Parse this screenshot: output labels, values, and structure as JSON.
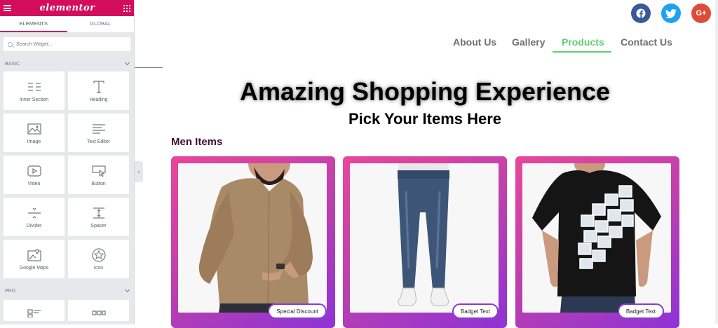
{
  "panel": {
    "brand": "elementor",
    "tabs": [
      "ELEMENTS",
      "GLOBAL"
    ],
    "search_placeholder": "Search Widget...",
    "basic_title": "BASIC",
    "pro_title": "PRO",
    "widgets": [
      {
        "label": "Inner Section",
        "icon": "inner-section-icon"
      },
      {
        "label": "Heading",
        "icon": "heading-icon"
      },
      {
        "label": "Image",
        "icon": "image-icon"
      },
      {
        "label": "Text Editor",
        "icon": "text-editor-icon"
      },
      {
        "label": "Video",
        "icon": "video-icon"
      },
      {
        "label": "Button",
        "icon": "button-icon"
      },
      {
        "label": "Divider",
        "icon": "divider-icon"
      },
      {
        "label": "Spacer",
        "icon": "spacer-icon"
      },
      {
        "label": "Google Maps",
        "icon": "google-maps-icon"
      },
      {
        "label": "Icon",
        "icon": "star-icon"
      }
    ]
  },
  "social": {
    "facebook": "f",
    "twitter": "t",
    "googleplus": "G+"
  },
  "nav": {
    "items": [
      "About Us",
      "Gallery",
      "Products",
      "Contact Us"
    ],
    "active": "Products"
  },
  "hero": {
    "title": "Amazing Shopping Experience",
    "subtitle": "Pick Your Items Here"
  },
  "section": {
    "title": "Men Items"
  },
  "cards": [
    {
      "badge": "Special Discount",
      "image": "man-in-brown-shirt"
    },
    {
      "badge": "Badget Text",
      "image": "blue-jeans-white-sneakers"
    },
    {
      "badge": "Badget Text",
      "image": "black-photo-print-tshirt"
    }
  ],
  "colors": {
    "brand": "#d30c5c",
    "nav_active": "#61ce70",
    "facebook": "#3b5998",
    "twitter": "#1da1f2",
    "googleplus": "#dd4b39"
  }
}
